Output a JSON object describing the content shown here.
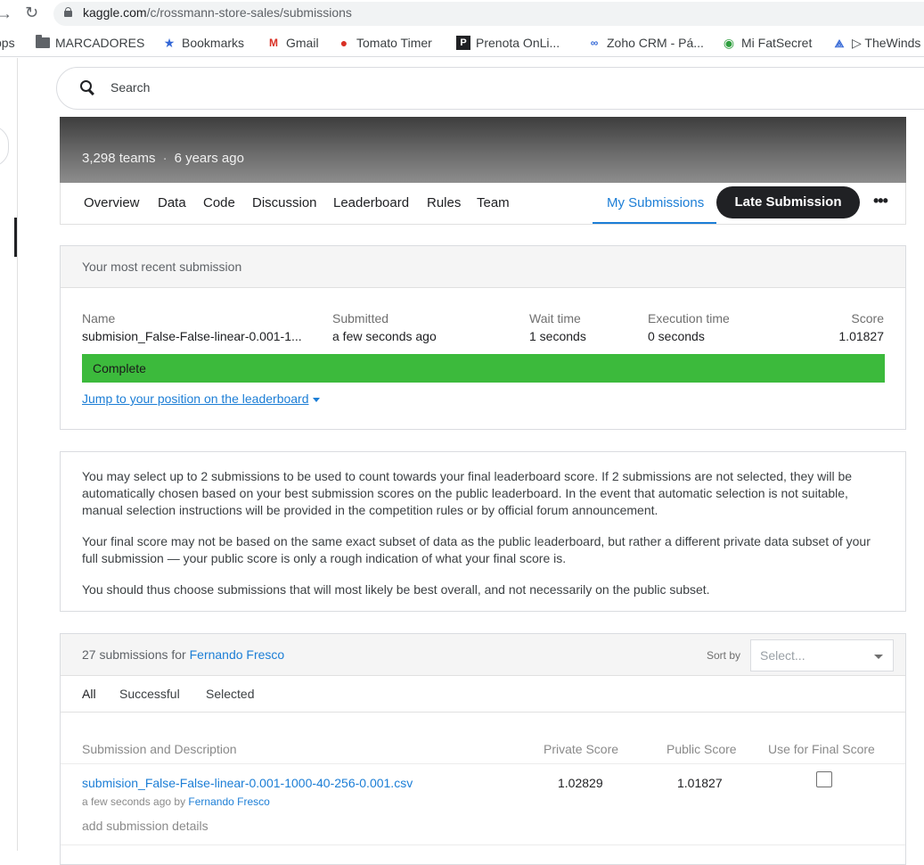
{
  "browser": {
    "url_host": "kaggle.com",
    "url_path": "/c/rossmann-store-sales/submissions",
    "bookmarks": [
      {
        "label": "pps",
        "icon": "apps-icon"
      },
      {
        "label": "MARCADORES",
        "icon": "folder-icon"
      },
      {
        "label": "Bookmarks",
        "icon": "star-icon"
      },
      {
        "label": "Gmail",
        "icon": "gmail-icon"
      },
      {
        "label": "Tomato Timer",
        "icon": "tomato-icon"
      },
      {
        "label": "Prenota OnLi...",
        "icon": "p-icon"
      },
      {
        "label": "Zoho CRM - Pá...",
        "icon": "zoho-icon"
      },
      {
        "label": "Mi FatSecret",
        "icon": "fatsecret-icon"
      },
      {
        "label": "▷ TheWinds",
        "icon": "winds-icon"
      }
    ]
  },
  "search": {
    "placeholder": "Search"
  },
  "competition": {
    "teams": "3,298 teams",
    "age": "6 years ago"
  },
  "tabs": {
    "overview": "Overview",
    "data": "Data",
    "code": "Code",
    "discussion": "Discussion",
    "leaderboard": "Leaderboard",
    "rules": "Rules",
    "team": "Team",
    "my_submissions": "My Submissions",
    "late_submission": "Late Submission",
    "more": "•••"
  },
  "recent": {
    "heading": "Your most recent submission",
    "name_label": "Name",
    "name_value": "submision_False-False-linear-0.001-1...",
    "submitted_label": "Submitted",
    "submitted_value": "a few seconds ago",
    "wait_label": "Wait time",
    "wait_value": "1 seconds",
    "exec_label": "Execution time",
    "exec_value": "0 seconds",
    "score_label": "Score",
    "score_value": "1.01827",
    "status": "Complete",
    "status_color": "#3cba3c",
    "jump_link": "Jump to your position on the leaderboard"
  },
  "info": {
    "p1": "You may select up to 2 submissions to be used to count towards your final leaderboard score. If 2 submissions are not selected, they will be automatically chosen based on your best submission scores on the public leaderboard. In the event that automatic selection is not suitable, manual selection instructions will be provided in the competition rules or by official forum announcement.",
    "p2": "Your final score may not be based on the same exact subset of data as the public leaderboard, but rather a different private data subset of your full submission — your public score is only a rough indication of what your final score is.",
    "p3": "You should thus choose submissions that will most likely be best overall, and not necessarily on the public subset."
  },
  "submissions": {
    "count_text": "27 submissions for",
    "user": "Fernando Fresco",
    "sort_label": "Sort by",
    "sort_placeholder": "Select...",
    "filters": [
      "All",
      "Successful",
      "Selected"
    ],
    "columns": {
      "description": "Submission and Description",
      "private": "Private Score",
      "public": "Public Score",
      "final": "Use for Final Score"
    },
    "rows": [
      {
        "file": "submision_False-False-linear-0.001-1000-40-256-0.001.csv",
        "when": "a few seconds ago by",
        "by": "Fernando Fresco",
        "private": "1.02829",
        "public": "1.01827",
        "add_details": "add submission details",
        "selected": false
      }
    ]
  },
  "colors": {
    "accent": "#1c7ed6",
    "dark_button": "#202124"
  }
}
